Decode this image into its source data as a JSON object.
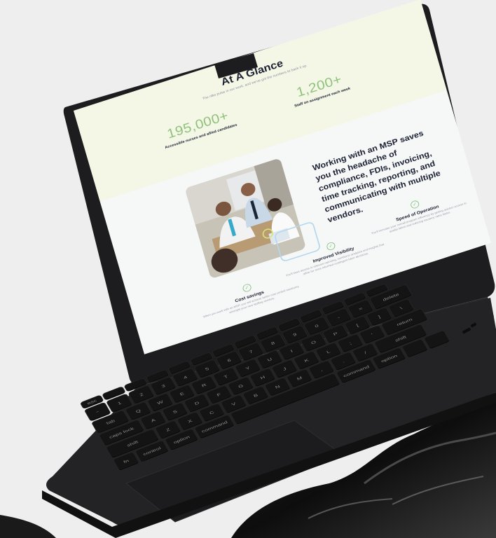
{
  "glance": {
    "title": "At A Glance",
    "subtitle": "The n8w pulse in our work, and we've got the numbers to back it up.",
    "stats": [
      {
        "value": "195,000+",
        "label": "Accessible nurses and allied candidates"
      },
      {
        "value": "1,200+",
        "label": "Staff on assignment each week"
      }
    ]
  },
  "pitch": "Working with an MSP saves you the headache of compliance, FDIs, invoicing, time tracking, reporting, and communicating with multiple vendors.",
  "benefits": [
    {
      "title": "Cost savings",
      "body": "When you work with an MSP, you will achieve better cost control measures amongst your new staffing vendors."
    },
    {
      "title": "Improved Visibility",
      "body": "You'll have access to relevant reporting, workforce analytics and insights that allow for more informed contingent labor decisions."
    },
    {
      "title": "Speed of Operation",
      "body": "You'll increase your overall program efficiency by getting quicker access to quality talent and reducing vacancy rates faster."
    }
  ],
  "keyboard": {
    "rows": [
      [
        "esc",
        "",
        "",
        "",
        "",
        "",
        "",
        "",
        "",
        "",
        "",
        "",
        "",
        ""
      ],
      [
        "~",
        "1",
        "2",
        "3",
        "4",
        "5",
        "6",
        "7",
        "8",
        "9",
        "0",
        "-",
        "=",
        "delete"
      ],
      [
        "tab",
        "Q",
        "W",
        "E",
        "R",
        "T",
        "Y",
        "U",
        "I",
        "O",
        "P",
        "[",
        "]",
        "\\"
      ],
      [
        "caps lock",
        "A",
        "S",
        "D",
        "F",
        "G",
        "H",
        "J",
        "K",
        "L",
        ";",
        "'",
        "return"
      ],
      [
        "shift",
        "Z",
        "X",
        "C",
        "V",
        "B",
        "N",
        "M",
        ",",
        ".",
        "/",
        "shift"
      ],
      [
        "fn",
        "control",
        "option",
        "command",
        "",
        "command",
        "option",
        "",
        ""
      ]
    ]
  },
  "colors": {
    "background": "#eeeeee",
    "laptop_body": "#1d1d1f",
    "glance_band": "#f4f6e6",
    "stat_accent": "#8fc27a",
    "heading": "#1c2233"
  }
}
